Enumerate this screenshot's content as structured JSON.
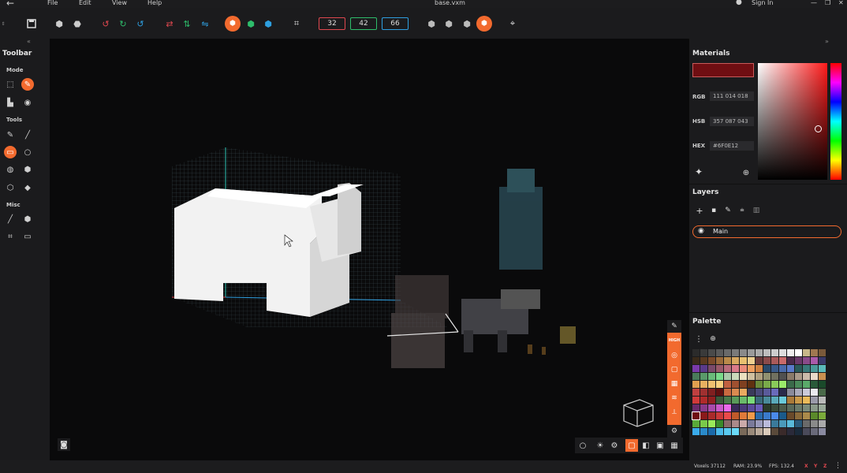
{
  "window": {
    "title": "base.vxm",
    "menu": [
      "File",
      "Edit",
      "View",
      "Help"
    ],
    "sign_in": "Sign In"
  },
  "toolbar": {
    "dims": [
      {
        "value": "32",
        "color": "#e0484f"
      },
      {
        "value": "42",
        "color": "#2ebd6b"
      },
      {
        "value": "66",
        "color": "#2e9fe0"
      }
    ]
  },
  "left_panel": {
    "title": "Toolbar",
    "sections": {
      "mode": "Mode",
      "tools": "Tools",
      "misc": "Misc"
    },
    "collapse": "«"
  },
  "right_panel": {
    "collapse": "»",
    "materials": {
      "title": "Materials",
      "swatch": "#6F0E12",
      "rgb_label": "RGB",
      "rgb": "111 014 018",
      "hsb_label": "HSB",
      "hsb": "357 087 043",
      "hex_label": "HEX",
      "hex": "#6F0E12"
    },
    "layers": {
      "title": "Layers",
      "items": [
        {
          "name": "Main",
          "visible": true
        }
      ]
    },
    "palette": {
      "title": "Palette"
    }
  },
  "viewport_side_tools": [
    "brush-icon",
    "HIGH",
    "chart-icon",
    "cube-icon",
    "building-icon",
    "layers-icon",
    "axis-icon"
  ],
  "status": {
    "voxels": "Voxels 37112",
    "ram": "RAM: 23.9%",
    "fps": "FPS: 132.4",
    "axes": [
      "X",
      "Y",
      "Z"
    ]
  },
  "accent": "#f26a2e"
}
